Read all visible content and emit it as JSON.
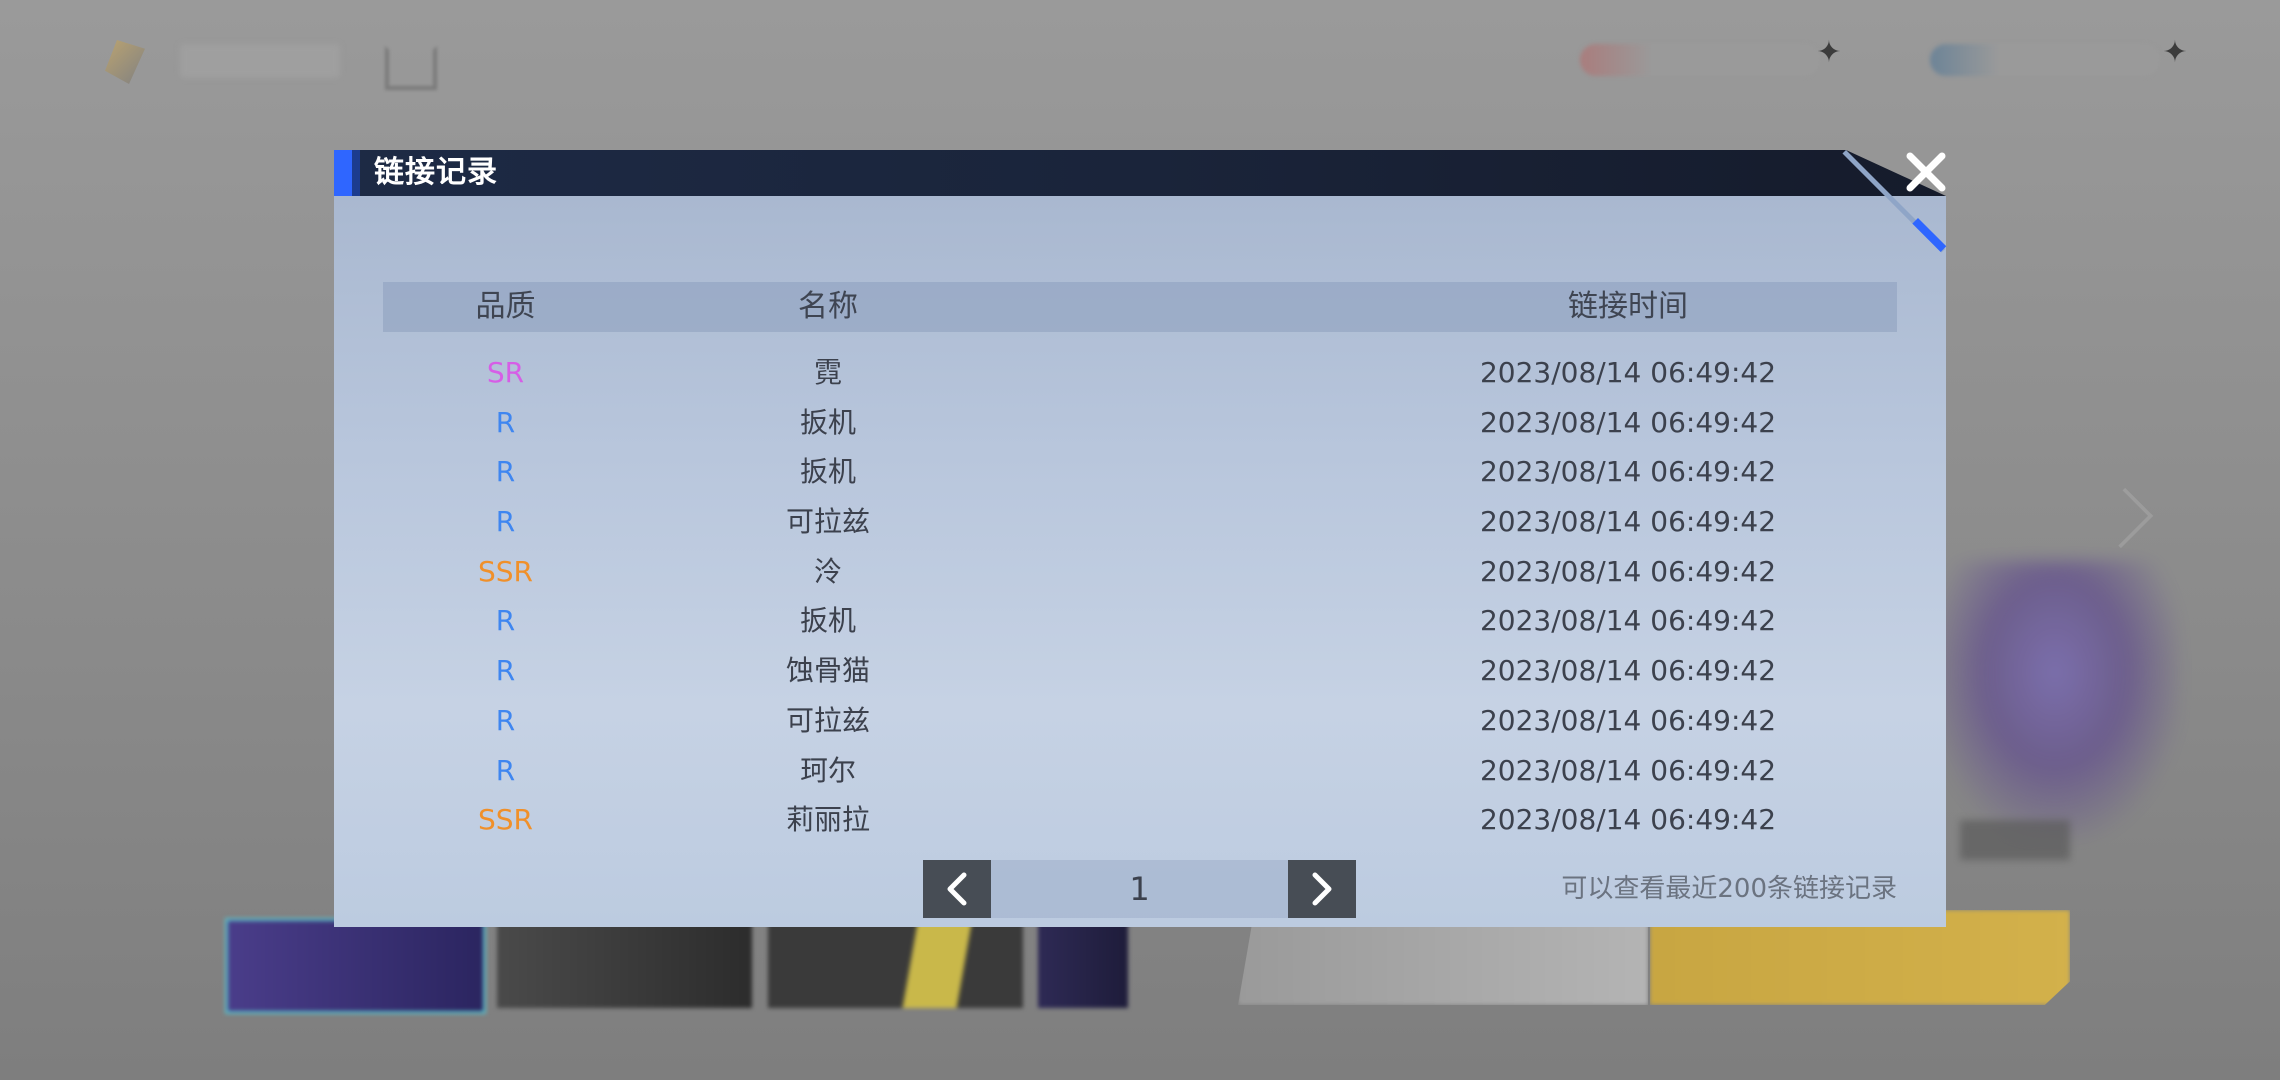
{
  "modal": {
    "title": "链接记录",
    "columns": {
      "quality": "品质",
      "name": "名称",
      "time": "链接时间"
    },
    "rows": [
      {
        "quality": "SR",
        "name": "霓",
        "time": "2023/08/14 06:49:42"
      },
      {
        "quality": "R",
        "name": "扳机",
        "time": "2023/08/14 06:49:42"
      },
      {
        "quality": "R",
        "name": "扳机",
        "time": "2023/08/14 06:49:42"
      },
      {
        "quality": "R",
        "name": "可拉兹",
        "time": "2023/08/14 06:49:42"
      },
      {
        "quality": "SSR",
        "name": "泠",
        "time": "2023/08/14 06:49:42"
      },
      {
        "quality": "R",
        "name": "扳机",
        "time": "2023/08/14 06:49:42"
      },
      {
        "quality": "R",
        "name": "蚀骨猫",
        "time": "2023/08/14 06:49:42"
      },
      {
        "quality": "R",
        "name": "可拉兹",
        "time": "2023/08/14 06:49:42"
      },
      {
        "quality": "R",
        "name": "珂尔",
        "time": "2023/08/14 06:49:42"
      },
      {
        "quality": "SSR",
        "name": "莉丽拉",
        "time": "2023/08/14 06:49:42"
      }
    ],
    "pagination": {
      "page": "1"
    },
    "note": "可以查看最近200条链接记录"
  },
  "colors": {
    "SSR": "#f0902a",
    "SR": "#d65ee6",
    "R": "#3f86f0",
    "header_accent": "#2f66ff"
  },
  "icons": {
    "close": "close-icon",
    "prev": "chevron-left-icon",
    "next": "chevron-right-icon"
  }
}
